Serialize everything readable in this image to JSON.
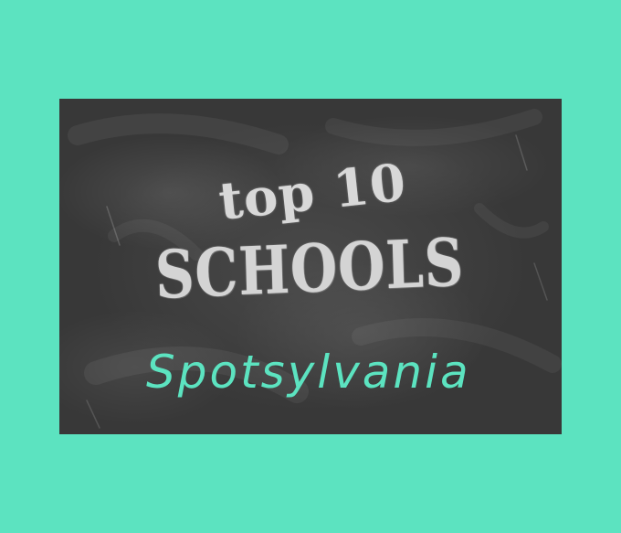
{
  "colors": {
    "background": "#5ce3c0",
    "chalkboard": "#3c3c3c",
    "chalk": "#d6d6d6",
    "accent_text": "#5ce3c0"
  },
  "graphic": {
    "line1": "top 10",
    "line2": "SCHOOLS",
    "line3": "Spotsylvania"
  }
}
